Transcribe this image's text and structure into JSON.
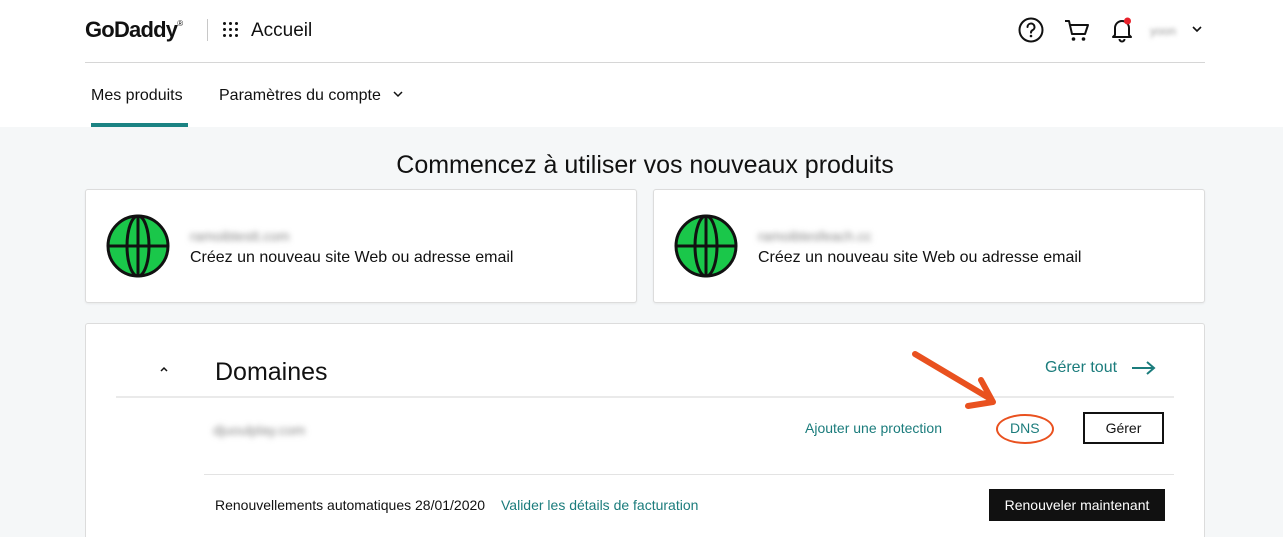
{
  "header": {
    "logo": "GoDaddy",
    "logo_mark": "®",
    "section": "Accueil",
    "user_name": "yoon",
    "icons": [
      "help-icon",
      "cart-icon",
      "bell-icon",
      "apps-grid-icon",
      "chevron-down-icon"
    ]
  },
  "tabs": [
    {
      "label": "Mes produits",
      "active": true
    },
    {
      "label": "Paramètres du compte",
      "active": false
    }
  ],
  "main": {
    "headline": "Commencez à utiliser vos nouveaux produits",
    "cards": [
      {
        "domain": "ramoibtestt.com",
        "text": "Créez un nouveau site Web ou adresse email"
      },
      {
        "domain": "ramoibtesfeach.cc",
        "text": "Créez un nouveau site Web ou adresse email"
      }
    ]
  },
  "domains_panel": {
    "title": "Domaines",
    "manage_all": "Gérer tout",
    "row": {
      "domain": "djuoulplay.com",
      "add_protection": "Ajouter une protection",
      "dns": "DNS",
      "manage": "Gérer"
    },
    "renewal_text": "Renouvellements automatiques 28/01/2020",
    "billing_link": "Valider les détails de facturation",
    "renew_now": "Renouveler maintenant"
  },
  "colors": {
    "accent": "#1b8383",
    "link": "#1b7c7c",
    "globe": "#1ac74a",
    "annotation": "#e9511f",
    "background": "#f5f7f8"
  }
}
